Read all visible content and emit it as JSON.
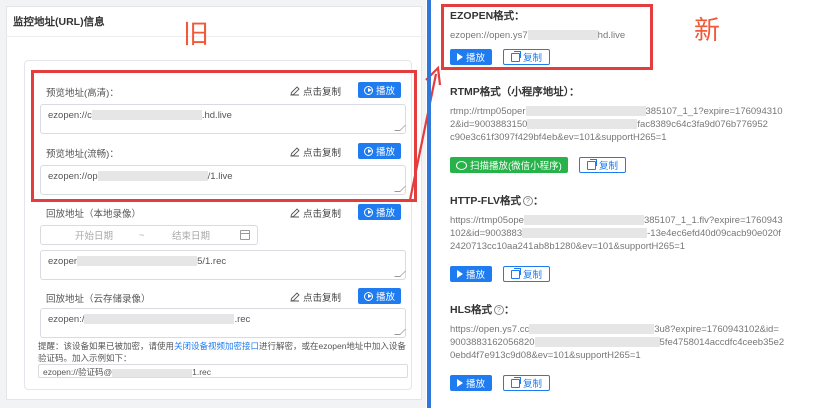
{
  "annotations": {
    "old": "旧",
    "new": "新"
  },
  "left": {
    "title": "监控地址(URL)信息",
    "preview_hd": {
      "label": "预览地址(高清)：",
      "copy": "点击复制",
      "play": "播放",
      "value_prefix": "ezopen://c",
      "value_suffix": ".hd.live"
    },
    "preview_sd": {
      "label": "预览地址(流畅)：",
      "copy": "点击复制",
      "play": "播放",
      "value_prefix": "ezopen://op",
      "value_suffix": "/1.live"
    },
    "playback_local": {
      "label": "回放地址（本地录像）",
      "copy": "点击复制",
      "play": "播放",
      "start_placeholder": "开始日期",
      "range_sep": "~",
      "end_placeholder": "结束日期",
      "value_prefix": "ezoper",
      "value_suffix": "5/1.rec"
    },
    "playback_cloud": {
      "label": "回放地址（云存储录像）",
      "copy": "点击复制",
      "play": "播放",
      "value_prefix": "ezopen:/",
      "value_suffix": ".rec"
    },
    "notice": {
      "prefix": "提醒：该设备如果已被加密，请使用",
      "link": "关闭设备视频加密接口",
      "suffix": "进行解密，或在ezopen地址中加入设备验证码。加入示例如下："
    },
    "example": {
      "prefix": "ezopen://验证码@",
      "suffix": "1.rec"
    }
  },
  "right": {
    "ezopen": {
      "title": "EZOPEN格式：",
      "url_prefix": "ezopen://open.ys7",
      "url_suffix": "hd.live",
      "play": "播放",
      "copy": "复制"
    },
    "rtmp": {
      "title": "RTMP格式（小程序地址）：",
      "line1_prefix": "rtmp://rtmp05oper",
      "line1_suffix": "385107_1_1?expire=176094310",
      "line2_prefix": "2&id=9003883150",
      "line2_suffix": "fac8389c64c3fa9d076b776952",
      "line3": "c90e3c61f3097f429bf4eb&ev=101&supportH265=1",
      "scan": "扫描播放(微信小程序)",
      "copy": "复制"
    },
    "flv": {
      "title": "HTTP-FLV格式",
      "line1_prefix": "https://rtmp05ope",
      "line1_suffix": "385107_1_1.flv?expire=1760943",
      "line2_prefix": "102&id=9003883",
      "line2_suffix": "-13e4ec6efd40d09cacb90e020f",
      "line3": "2420713cc10aa241ab8b1280&ev=101&supportH265=1",
      "play": "播放",
      "copy": "复制"
    },
    "hls": {
      "title": "HLS格式",
      "line1_prefix": "https://open.ys7.cc",
      "line1_suffix": "3u8?expire=1760943102&id=",
      "line2_prefix": "9003883162056820",
      "line2_suffix": "5fe4758014accdfc4ceeb35e2",
      "line3": "0ebd4f7e913c9d08&ev=101&supportH265=1",
      "play": "播放",
      "copy": "复制"
    }
  }
}
